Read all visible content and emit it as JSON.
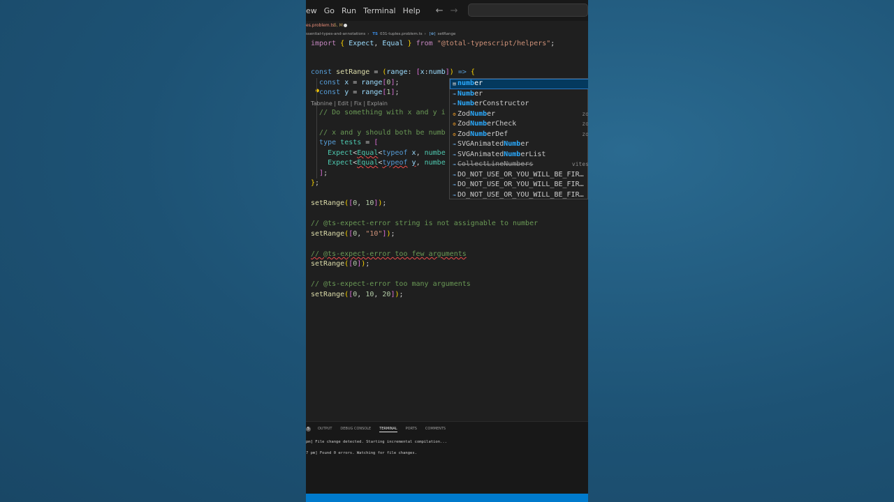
{
  "menubar": {
    "items": [
      "ew",
      "Go",
      "Run",
      "Terminal",
      "Help"
    ],
    "back_icon": "arrow-left-icon",
    "forward_icon": "arrow-right-icon"
  },
  "tab": {
    "name": "es.problem.ts",
    "status": "5, M"
  },
  "breadcrumb": {
    "folder": "ssential-types-and-annotations",
    "file_badge": "TS",
    "file": "031-tuples.problem.ts",
    "symbol": "setRange"
  },
  "codelens": "Tabnine | Edit | Fix | Explain",
  "suggest": {
    "items": [
      {
        "label": "number",
        "match": "numb",
        "rest": "er",
        "icon": "keyword-icon",
        "detail": ""
      },
      {
        "label": "Number",
        "match": "Numb",
        "rest": "er",
        "icon": "variable-icon",
        "detail": ""
      },
      {
        "label": "NumberConstructor",
        "match": "Numb",
        "rest": "erConstructor",
        "icon": "interface-icon",
        "detail": ""
      },
      {
        "label": "ZodNumber",
        "pre": "Zod",
        "match": "Numb",
        "rest": "er",
        "icon": "class-icon",
        "detail": "zo"
      },
      {
        "label": "ZodNumberCheck",
        "pre": "Zod",
        "match": "Numb",
        "rest": "erCheck",
        "icon": "class-icon",
        "detail": "zo"
      },
      {
        "label": "ZodNumberDef",
        "pre": "Zod",
        "match": "Numb",
        "rest": "erDef",
        "icon": "class-icon",
        "detail": "zo"
      },
      {
        "label": "SVGAnimatedNumber",
        "pre": "SVGAnimated",
        "match": "Numb",
        "rest": "er",
        "icon": "variable-icon",
        "detail": ""
      },
      {
        "label": "SVGAnimatedNumberList",
        "pre": "SVGAnimated",
        "match": "Numb",
        "rest": "erList",
        "icon": "variable-icon",
        "detail": ""
      },
      {
        "label": "CollectLineNumbers",
        "icon": "variable-icon",
        "detail": "vites",
        "deprecated": true
      },
      {
        "label": "DO_NOT_USE_OR_YOU_WILL_BE_FIR…",
        "icon": "interface-icon",
        "detail": ""
      },
      {
        "label": "DO_NOT_USE_OR_YOU_WILL_BE_FIR…",
        "icon": "interface-icon",
        "detail": ""
      },
      {
        "label": "DO_NOT_USE_OR_YOU_WILL_BE_FIR…",
        "icon": "interface-icon",
        "detail": ""
      }
    ]
  },
  "panel": {
    "badge": "5",
    "tabs": [
      "OUTPUT",
      "DEBUG CONSOLE",
      "TERMINAL",
      "PORTS",
      "COMMENTS"
    ],
    "active_tab": "TERMINAL",
    "terminal_lines": [
      "pm] File change detected. Starting incremental compilation...",
      "7 pm] Found 0 errors. Watching for file changes."
    ]
  },
  "colors": {
    "background": "#1e5678",
    "editor_bg": "#1f1f1f",
    "statusbar": "#007acc",
    "suggest_selected": "#04395e",
    "match_highlight": "#2aaaff"
  }
}
